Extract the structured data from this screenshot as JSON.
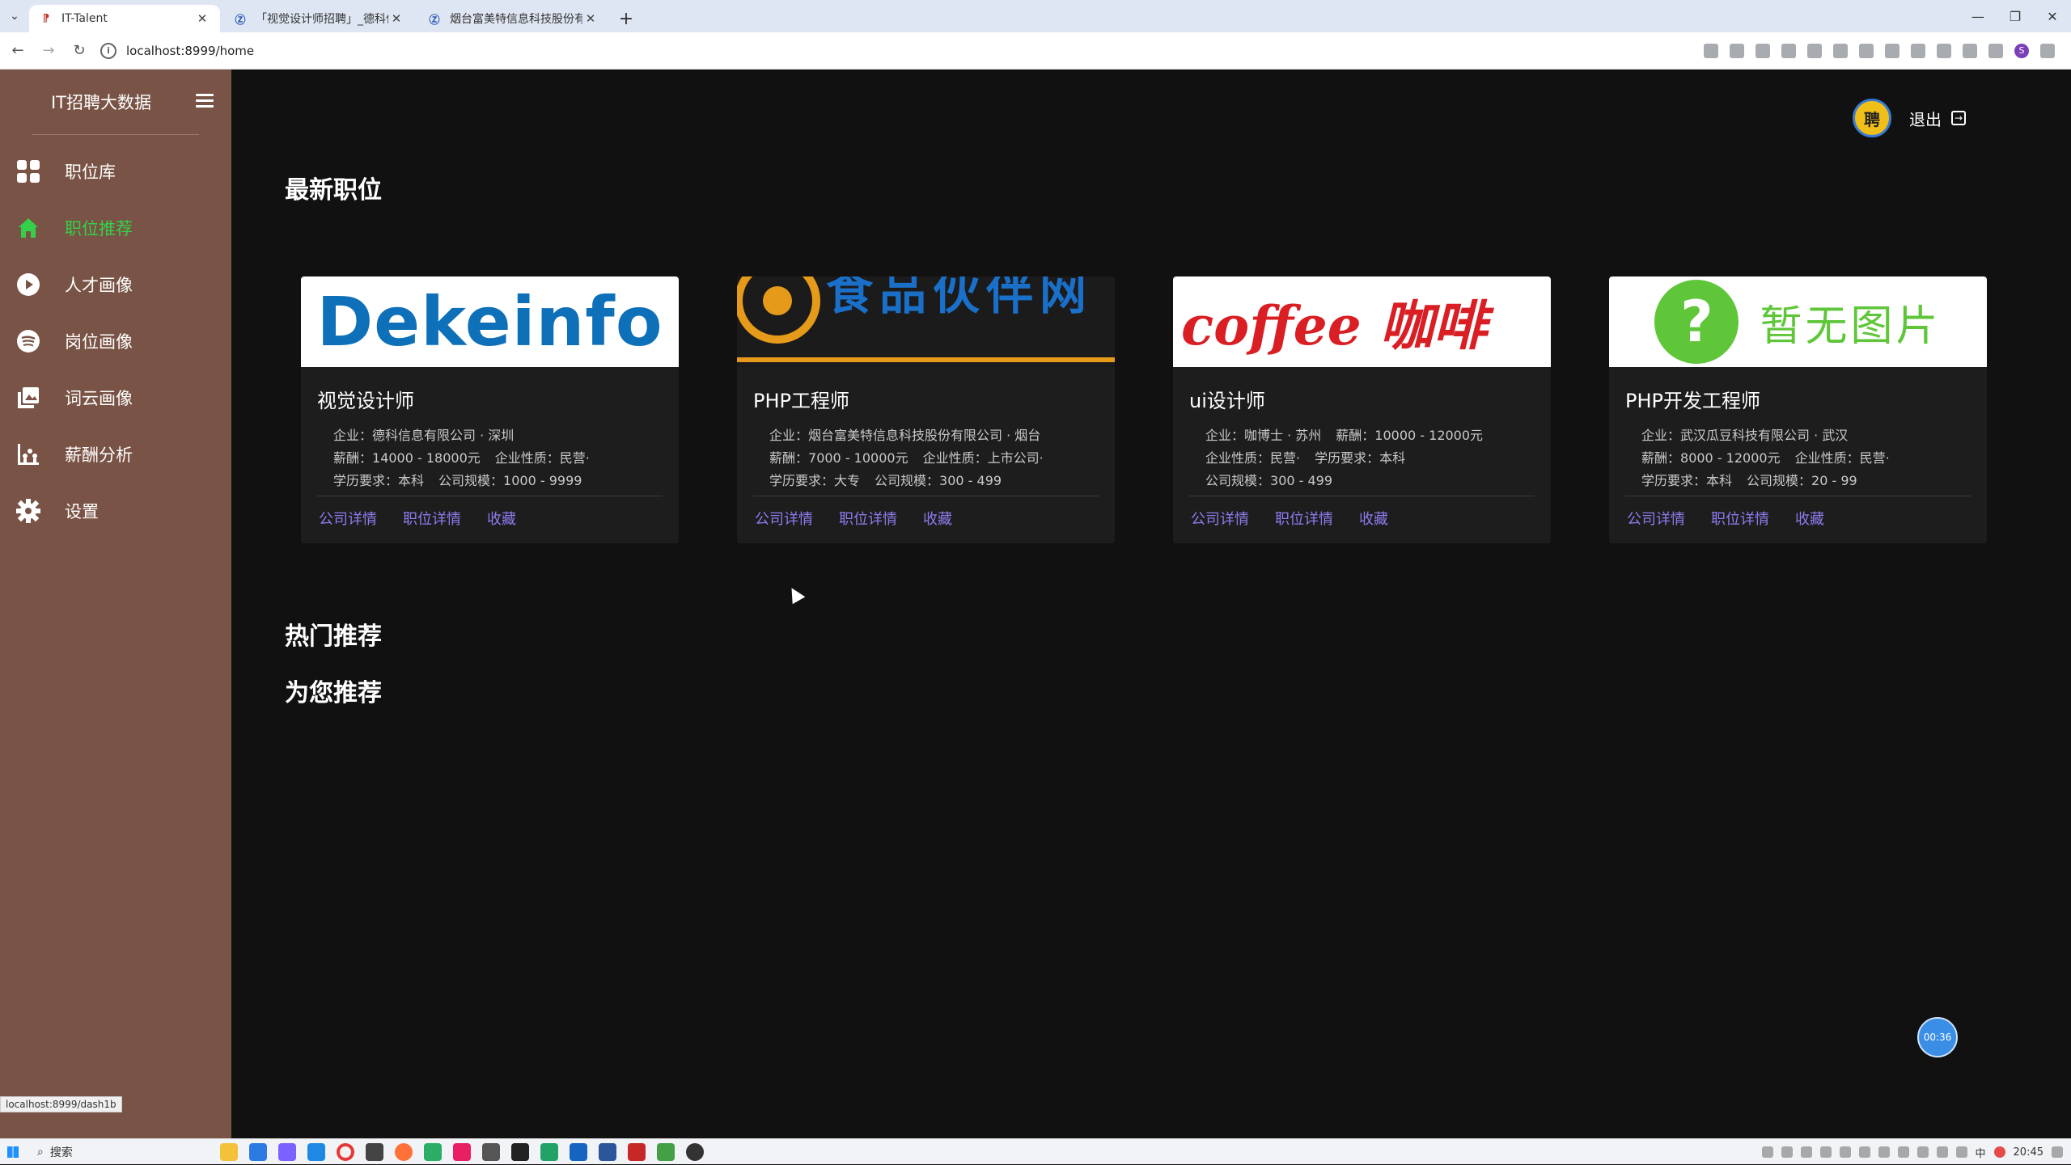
{
  "browser": {
    "tabs": [
      {
        "title": "IT-Talent",
        "active": true,
        "favicon": "it-logo-icon"
      },
      {
        "title": "「视觉设计师招聘」_德科信息",
        "active": false,
        "favicon": "document-icon"
      },
      {
        "title": "烟台富美特信息科技股份有限",
        "active": false,
        "favicon": "document-icon"
      }
    ],
    "new_tab": "+",
    "url": "localhost:8999/home",
    "status_url": "localhost:8999/dash1b"
  },
  "sidebar": {
    "brand": "IT招聘大数据",
    "items": [
      {
        "label": "职位库",
        "icon": "grid-icon",
        "active": false
      },
      {
        "label": "职位推荐",
        "icon": "home-icon",
        "active": true
      },
      {
        "label": "人才画像",
        "icon": "play-circle-icon",
        "active": false
      },
      {
        "label": "岗位画像",
        "icon": "spotify-icon",
        "active": false
      },
      {
        "label": "词云画像",
        "icon": "photo-stack-icon",
        "active": false
      },
      {
        "label": "薪酬分析",
        "icon": "chart-icon",
        "active": false
      },
      {
        "label": "设置",
        "icon": "gear-icon",
        "active": false
      }
    ]
  },
  "header": {
    "avatar_text": "聘",
    "logout_label": "退出"
  },
  "sections": {
    "latest": "最新职位",
    "hot": "热门推荐",
    "for_you": "为您推荐"
  },
  "cards": [
    {
      "title": "视觉设计师",
      "image_text": "Dekeinfo",
      "lines": [
        [
          "企业：",
          "德科信息有限公司 · 深圳"
        ],
        [
          "薪酬：",
          "14000 - 18000元",
          "企业性质：",
          "民营·"
        ],
        [
          "学历要求：",
          "本科",
          "公司规模：",
          "1000 - 9999"
        ]
      ],
      "links": [
        "公司详情",
        "职位详情",
        "收藏"
      ]
    },
    {
      "title": "PHP工程师",
      "image_text": "食品伙伴网",
      "lines": [
        [
          "企业：",
          "烟台富美特信息科技股份有限公司 · 烟台"
        ],
        [
          "薪酬：",
          "7000 - 10000元",
          "企业性质：",
          "上市公司·"
        ],
        [
          "学历要求：",
          "大专",
          "公司规模：",
          "300 - 499"
        ]
      ],
      "links": [
        "公司详情",
        "职位详情",
        "收藏"
      ]
    },
    {
      "title": "ui设计师",
      "image_text": "coffee 咖啡",
      "lines": [
        [
          "企业：",
          "咖博士 · 苏州",
          "薪酬：",
          "10000 - 12000元"
        ],
        [
          "企业性质：",
          "民营·",
          "学历要求：",
          "本科"
        ],
        [
          "公司规模：",
          "300 - 499"
        ]
      ],
      "links": [
        "公司详情",
        "职位详情",
        "收藏"
      ]
    },
    {
      "title": "PHP开发工程师",
      "image_text": "暂无图片",
      "lines": [
        [
          "企业：",
          "武汉瓜豆科技有限公司 · 武汉"
        ],
        [
          "薪酬：",
          "8000 - 12000元",
          "企业性质：",
          "民营·"
        ],
        [
          "学历要求：",
          "本科",
          "公司规模：",
          "20 - 99"
        ]
      ],
      "links": [
        "公司详情",
        "职位详情",
        "收藏"
      ]
    }
  ],
  "timer": "00:36",
  "taskbar": {
    "search_label": "搜索",
    "time": "20:45",
    "ime": "中"
  },
  "colors": {
    "sidebar_bg": "#795345",
    "active_nav": "#35d04a",
    "link": "#8e7cf0",
    "page_bg": "#111111",
    "card_bg": "#1d1d1d"
  }
}
